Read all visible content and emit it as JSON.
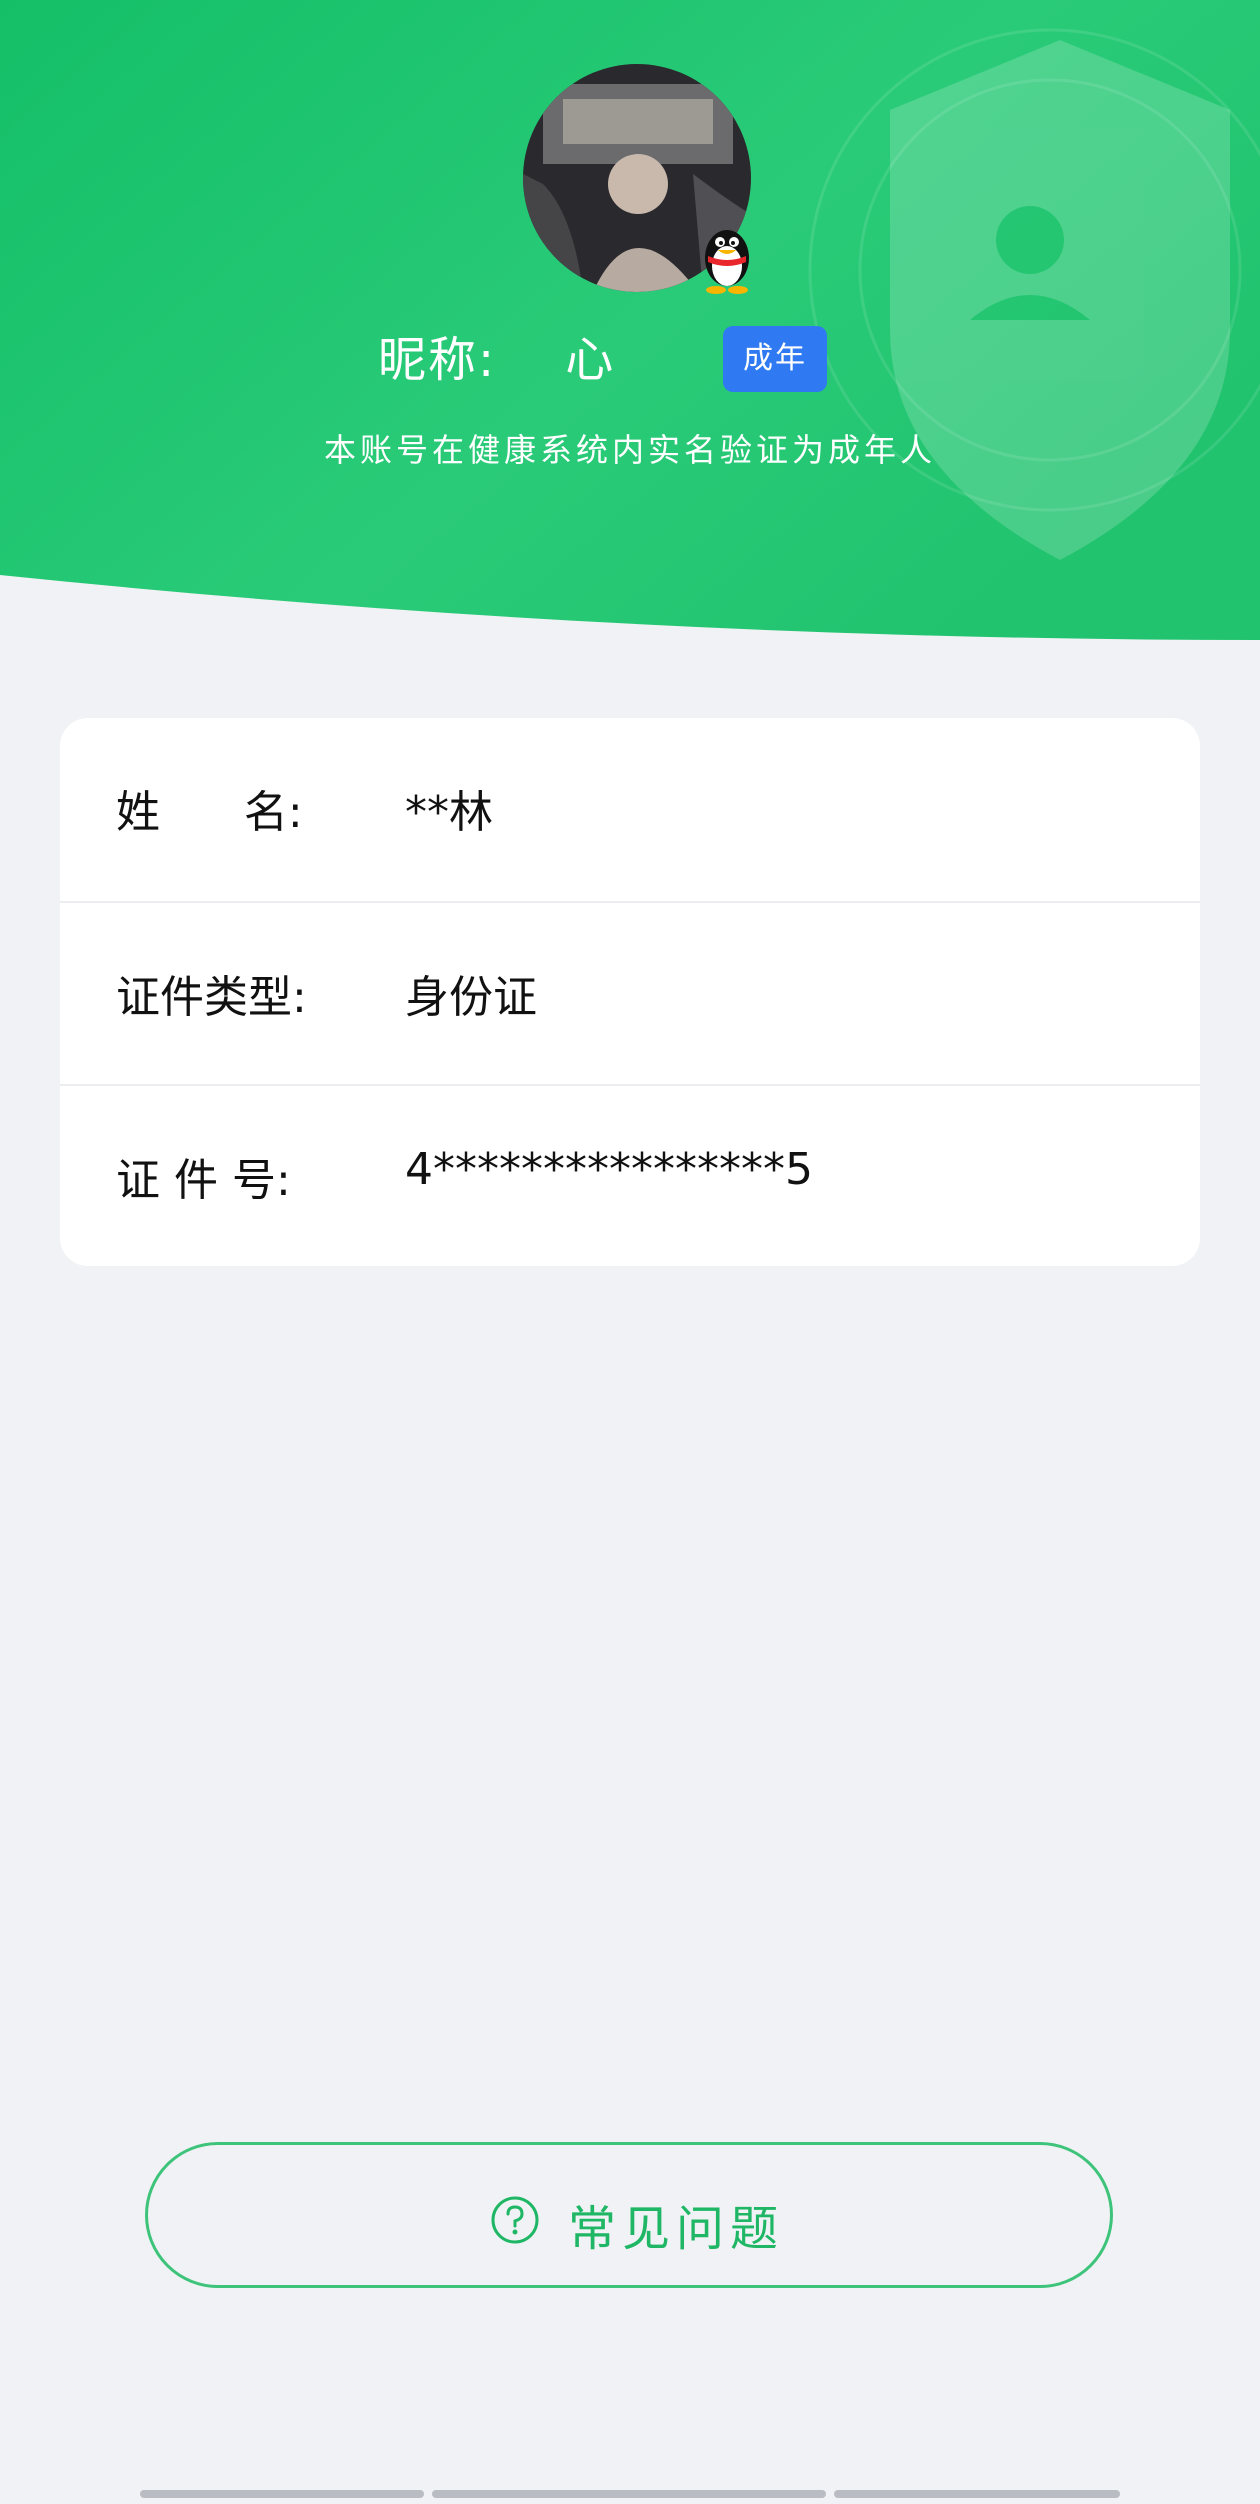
{
  "colors": {
    "header_green": "#1fc26c",
    "adult_badge_blue": "#2f7af2",
    "faq_green": "#1fb765",
    "page_bg": "#f0f2f5"
  },
  "profile": {
    "nickname": "昵称:    心",
    "adult_badge": "成年",
    "verification_note": "本账号在健康系统内实名验证为成年人",
    "avatar_icon": "user-photo",
    "platform_icon": "qq-penguin-icon"
  },
  "identity": {
    "rows": [
      {
        "label": "姓      名:",
        "value": "**林"
      },
      {
        "label": "证件类型:",
        "value": "身份证"
      },
      {
        "label": "证 件 号:",
        "value": "4****************5"
      }
    ]
  },
  "faq": {
    "icon": "question-circle-icon",
    "label": "常见问题"
  }
}
